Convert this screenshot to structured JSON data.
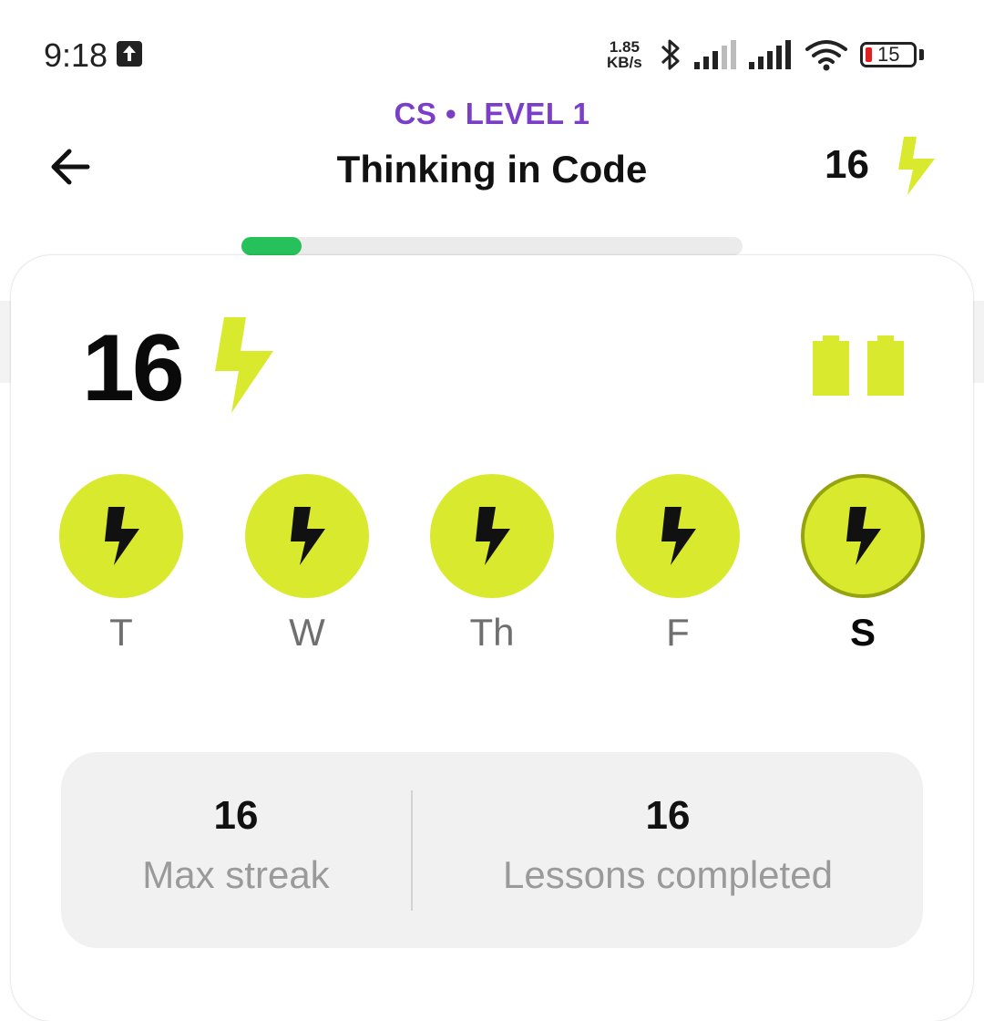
{
  "status_bar": {
    "time": "9:18",
    "net_speed_value": "1.85",
    "net_speed_unit": "KB/s",
    "battery_level": "15"
  },
  "header": {
    "course_tag": "CS • LEVEL 1",
    "title": "Thinking in Code",
    "energy_count": "16",
    "progress_fraction": 0.12
  },
  "streak": {
    "count": "16",
    "freeze_count": 2,
    "days": [
      {
        "label": "T",
        "completed": true,
        "today": false
      },
      {
        "label": "W",
        "completed": true,
        "today": false
      },
      {
        "label": "Th",
        "completed": true,
        "today": false
      },
      {
        "label": "F",
        "completed": true,
        "today": false
      },
      {
        "label": "S",
        "completed": true,
        "today": true
      }
    ]
  },
  "stats": {
    "max_streak_value": "16",
    "max_streak_label": "Max streak",
    "lessons_value": "16",
    "lessons_label": "Lessons completed"
  },
  "colors": {
    "accent_purple": "#7b3fc7",
    "bolt_yellow": "#d9e92e",
    "progress_green": "#27c15b"
  },
  "icons": [
    "upload-icon",
    "bluetooth-icon",
    "signal-icon",
    "wifi-icon",
    "battery-icon",
    "back-arrow-icon",
    "bolt-icon",
    "streak-freeze-icon"
  ]
}
